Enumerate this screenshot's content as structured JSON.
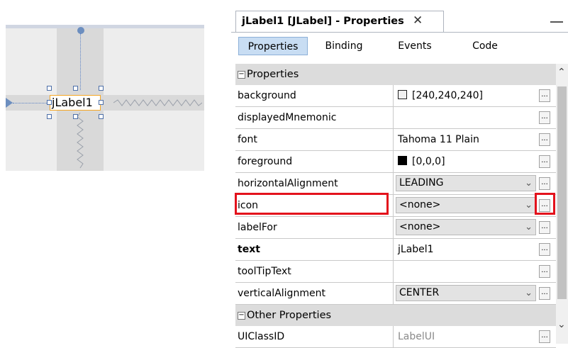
{
  "designer": {
    "component_label": "jLabel1"
  },
  "panel": {
    "title": "jLabel1 [JLabel] - Properties",
    "close_glyph": "✕",
    "tabs": [
      {
        "label": "Properties",
        "active": true
      },
      {
        "label": "Binding",
        "active": false
      },
      {
        "label": "Events",
        "active": false
      },
      {
        "label": "Code",
        "active": false
      }
    ],
    "categories": {
      "properties": {
        "label": "Properties",
        "toggle": "−"
      },
      "other": {
        "label": "Other Properties",
        "toggle": "−"
      }
    },
    "rows": {
      "background": {
        "name": "background",
        "value": "[240,240,240]",
        "swatch_color": "#f0f0f0",
        "ellipsis": "..."
      },
      "displayedMnemonic": {
        "name": "displayedMnemonic",
        "value": "",
        "ellipsis": "..."
      },
      "font": {
        "name": "font",
        "value": "Tahoma 11 Plain",
        "ellipsis": "..."
      },
      "foreground": {
        "name": "foreground",
        "value": "[0,0,0]",
        "swatch_color": "#000000",
        "ellipsis": "..."
      },
      "horizontalAlignment": {
        "name": "horizontalAlignment",
        "value": "LEADING",
        "ellipsis": "..."
      },
      "icon": {
        "name": "icon",
        "value": "<none>",
        "ellipsis": "..."
      },
      "labelFor": {
        "name": "labelFor",
        "value": "<none>",
        "ellipsis": "..."
      },
      "text": {
        "name": "text",
        "value": "jLabel1",
        "ellipsis": "..."
      },
      "toolTipText": {
        "name": "toolTipText",
        "value": "",
        "ellipsis": "..."
      },
      "verticalAlignment": {
        "name": "verticalAlignment",
        "value": "CENTER",
        "ellipsis": "..."
      },
      "UIClassID": {
        "name": "UIClassID",
        "value": "LabelUI",
        "ellipsis": "..."
      }
    }
  },
  "colors": {
    "highlight": "#e3121c",
    "selection_border": "#f5a623",
    "active_tab": "#c8ddf3"
  }
}
